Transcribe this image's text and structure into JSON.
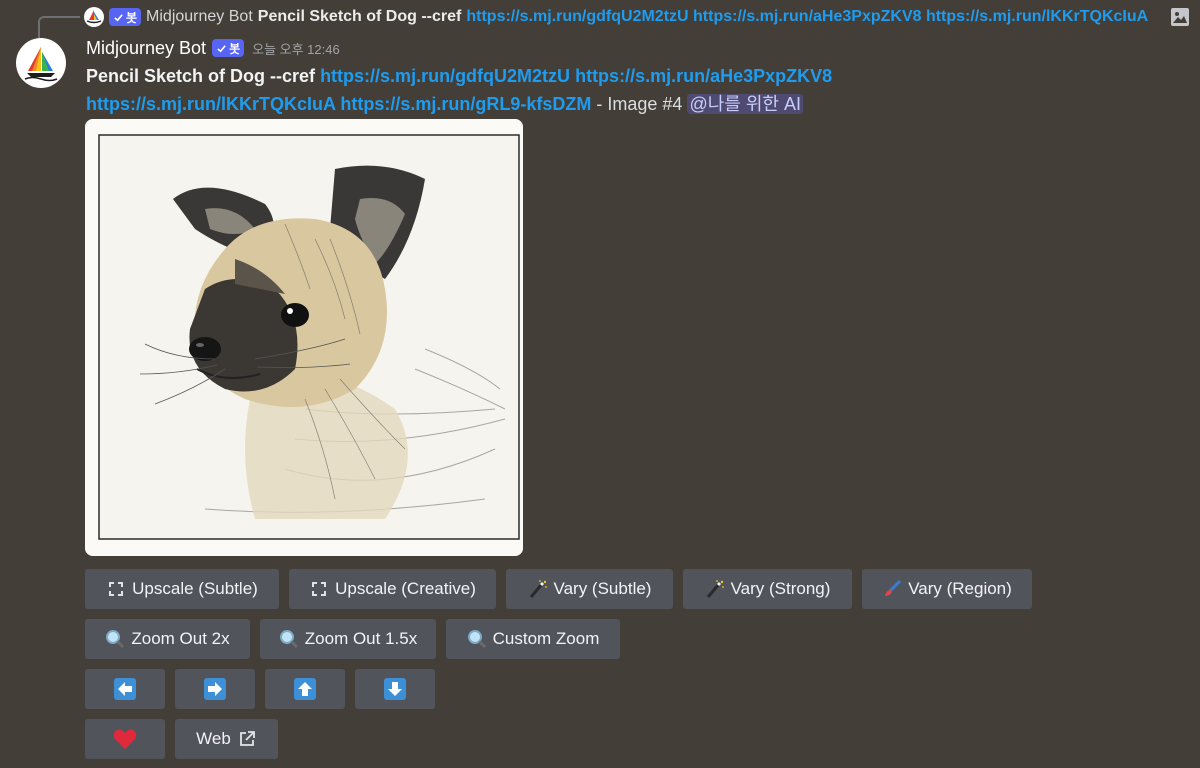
{
  "reply": {
    "author": "Midjourney Bot",
    "bot_badge": "봇",
    "text": "Pencil Sketch of Dog --cref",
    "links": "https://s.mj.run/gdfqU2M2tzU https://s.mj.run/aHe3PxpZKV8 https://s.mj.run/lKKrTQKcIuA"
  },
  "message": {
    "author": "Midjourney Bot",
    "bot_badge": "봇",
    "timestamp": "오늘 오후 12:46",
    "prompt": "Pencil Sketch of Dog --cref",
    "link1": "https://s.mj.run/gdfqU2M2tzU",
    "link2": "https://s.mj.run/aHe3PxpZKV8",
    "link3": "https://s.mj.run/lKKrTQKcIuA",
    "link4": "https://s.mj.run/gRL9-kfsDZM",
    "suffix": "- Image #4",
    "mention": "@나를 위한 AI"
  },
  "buttons": {
    "upscale_subtle": "Upscale (Subtle)",
    "upscale_creative": "Upscale (Creative)",
    "vary_subtle": "Vary (Subtle)",
    "vary_strong": "Vary (Strong)",
    "vary_region": "Vary (Region)",
    "zoom_out_2x": "Zoom Out 2x",
    "zoom_out_15x": "Zoom Out 1.5x",
    "custom_zoom": "Custom Zoom",
    "web": "Web"
  },
  "colors": {
    "background": "#433e37",
    "button": "#52545b",
    "link": "#1e9cf0",
    "bot_tag": "#5865f2",
    "mention_bg": "#4f4a72"
  }
}
